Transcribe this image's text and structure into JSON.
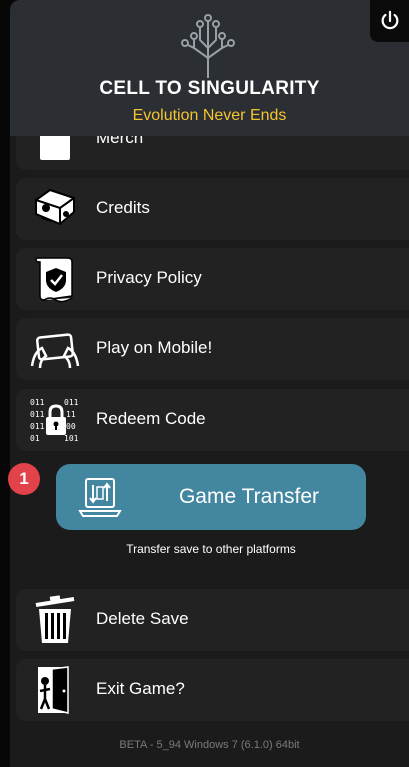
{
  "header": {
    "title": "CELL TO SINGULARITY",
    "subtitle": "Evolution Never Ends",
    "logo_icon": "tree-of-life-icon",
    "power_icon": "power-icon"
  },
  "menu": {
    "items": [
      {
        "label": "Merch",
        "icon": "merch-icon"
      },
      {
        "label": "Credits",
        "icon": "credits-icon"
      },
      {
        "label": "Privacy Policy",
        "icon": "privacy-policy-icon"
      },
      {
        "label": "Play on Mobile!",
        "icon": "mobile-icon"
      },
      {
        "label": "Redeem Code",
        "icon": "redeem-code-icon"
      },
      {
        "label": "Delete Save",
        "icon": "trash-icon"
      },
      {
        "label": "Exit Game?",
        "icon": "exit-door-icon"
      }
    ]
  },
  "transfer": {
    "label": "Game Transfer",
    "caption": "Transfer save to other platforms",
    "badge": "1",
    "icon": "laptop-transfer-icon"
  },
  "binary_code": {
    "line1": "011",
    "line2": "011",
    "line3": "011",
    "line4": "01",
    "right1": "011",
    "right2": "11",
    "right3": "00",
    "right4": "101"
  },
  "footer": {
    "version": "BETA - 5_94 Windows 7  (6.1.0) 64bit"
  },
  "colors": {
    "accent_button": "#43869f",
    "subtitle": "#f3c431",
    "badge": "#e2424a",
    "panel": "#1b1b1b",
    "header": "#2b2e33"
  }
}
